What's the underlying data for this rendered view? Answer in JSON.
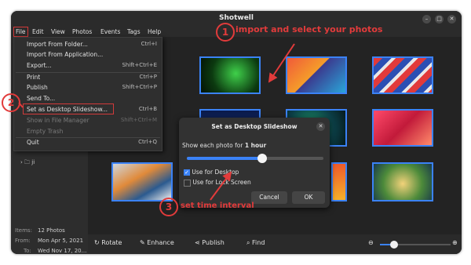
{
  "window": {
    "title": "Shotwell"
  },
  "menubar": [
    "File",
    "Edit",
    "View",
    "Photos",
    "Events",
    "Tags",
    "Help"
  ],
  "file_menu": {
    "items": [
      {
        "label": "Import From Folder...",
        "accel": "Ctrl+I",
        "enabled": true
      },
      {
        "label": "Import From Application...",
        "accel": "",
        "enabled": true
      },
      {
        "label": "Export...",
        "accel": "Shift+Ctrl+E",
        "enabled": true
      },
      {
        "label": "Print",
        "accel": "Ctrl+P",
        "enabled": true
      },
      {
        "label": "Publish",
        "accel": "Shift+Ctrl+P",
        "enabled": true
      },
      {
        "label": "Send To...",
        "accel": "",
        "enabled": true
      },
      {
        "label": "Set as Desktop Slideshow...",
        "accel": "Ctrl+B",
        "enabled": true
      },
      {
        "label": "Show in File Manager",
        "accel": "Shift+Ctrl+M",
        "enabled": false
      },
      {
        "label": "Empty Trash",
        "accel": "",
        "enabled": false
      },
      {
        "label": "Quit",
        "accel": "Ctrl+Q",
        "enabled": true
      }
    ]
  },
  "sidebar": {
    "folder_label": "ji",
    "info": {
      "items_label": "Items:",
      "items_value": "12 Photos",
      "from_label": "From:",
      "from_value": "Mon Apr 5, 2021",
      "to_label": "To:",
      "to_value": "Wed Nov 17, 20..."
    }
  },
  "toolbar": {
    "rotate": "Rotate",
    "enhance": "Enhance",
    "publish": "Publish",
    "find": "Find",
    "zoom_level": 0.2
  },
  "dialog": {
    "title": "Set as Desktop Slideshow",
    "prompt": "Show each photo for",
    "duration": "1 hour",
    "slider_position": 0.55,
    "use_desktop": "Use for Desktop",
    "use_lock": "Use for Lock Screen",
    "use_desktop_checked": true,
    "use_lock_checked": false,
    "cancel": "Cancel",
    "ok": "OK"
  },
  "annotations": {
    "n1": "1",
    "t1": "import and select your photos",
    "n2": "2",
    "n3": "3",
    "t3": "set time interval",
    "color": "#e23b3b"
  }
}
